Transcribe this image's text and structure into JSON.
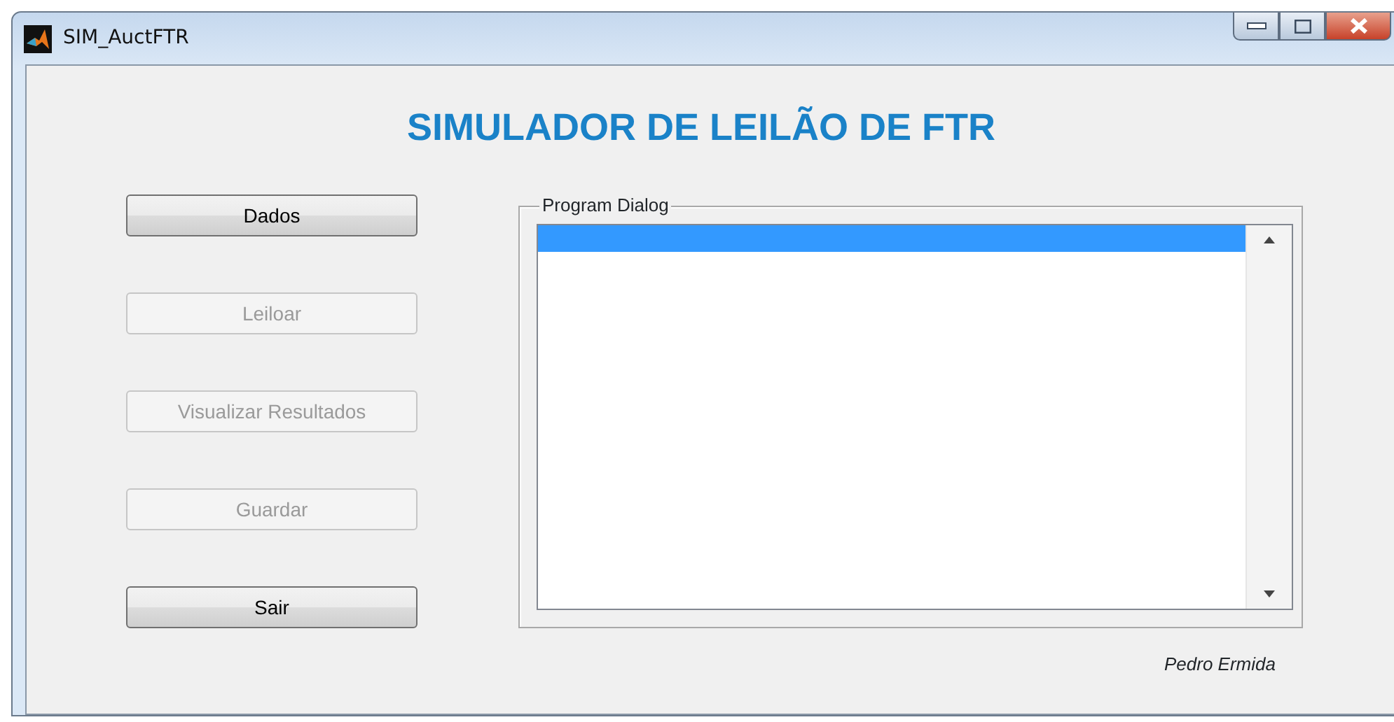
{
  "window": {
    "title": "SIM_AuctFTR"
  },
  "heading": "SIMULADOR DE LEILÃO DE FTR",
  "buttons": [
    {
      "label": "Dados",
      "disabled": false
    },
    {
      "label": "Leiloar",
      "disabled": true
    },
    {
      "label": "Visualizar Resultados",
      "disabled": true
    },
    {
      "label": "Guardar",
      "disabled": true
    },
    {
      "label": "Sair",
      "disabled": false
    }
  ],
  "dialog": {
    "title": "Program Dialog",
    "items": [
      {
        "selected": true
      }
    ]
  },
  "footer": "Pedro Ermida"
}
